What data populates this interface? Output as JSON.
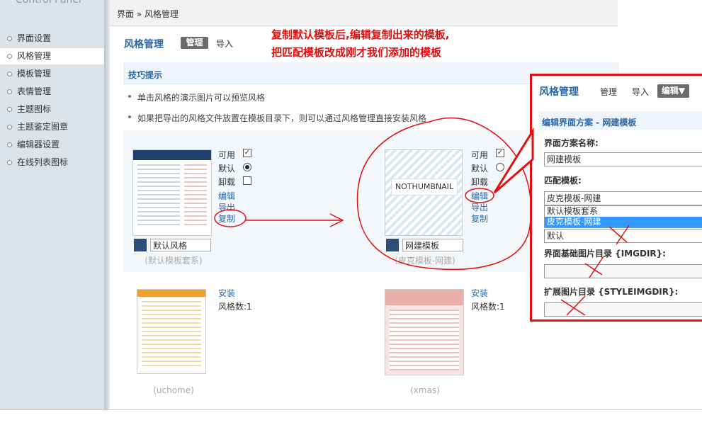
{
  "brand": "Control Panel",
  "nav": {
    "items": [
      {
        "label": "界面设置"
      },
      {
        "label": "风格管理",
        "active": true
      },
      {
        "label": "模板管理"
      },
      {
        "label": "表情管理"
      },
      {
        "label": "主题图标"
      },
      {
        "label": "主题鉴定图章"
      },
      {
        "label": "编辑器设置"
      },
      {
        "label": "在线列表图标"
      }
    ]
  },
  "breadcrumb": "界面 » 风格管理",
  "page": {
    "title": "风格管理",
    "tab_manage": "管理",
    "tab_import": "导入"
  },
  "annotation": {
    "line1": "复制默认模板后,编辑复制出来的模板,",
    "line2": "把匹配模板改成刚才我们添加的模板"
  },
  "tips": {
    "title": "技巧提示",
    "items": [
      "单击风格的演示图片可以预览风格",
      "如果把导出的风格文件放置在模板目录下，则可以通过风格管理直接安装风格"
    ]
  },
  "styles": [
    {
      "name": "默认风格",
      "template": "(默认模板套系)",
      "enabled_label": "可用",
      "default_label": "默认",
      "uninstall_label": "卸载",
      "edit": "编辑",
      "export": "导出",
      "copy": "复制",
      "enabled": true,
      "is_default": true
    },
    {
      "name": "网建模板",
      "template": "(皮克模板-网建)",
      "thumb_text": "NOTHUMBNAIL",
      "enabled_label": "可用",
      "default_label": "默认",
      "uninstall_label": "卸载",
      "edit": "编辑",
      "export": "导出",
      "copy": "复制",
      "enabled": true,
      "is_default": false
    }
  ],
  "installables": [
    {
      "install": "安装",
      "count": "风格数:1",
      "caption": "(uchome)"
    },
    {
      "install": "安装",
      "count": "风格数:1",
      "caption": "(xmas)"
    }
  ],
  "overlay": {
    "title": "风格管理",
    "tab_manage": "管理",
    "tab_import": "导入",
    "tab_edit": "编辑▼",
    "section": "编辑界面方案 - 网建模板",
    "name_label": "界面方案名称:",
    "name_value": "网建模板",
    "match_label": "匹配模板:",
    "match_selected": "皮克模板-网建",
    "match_options": [
      "默认模板套系",
      "皮克模板-网建"
    ],
    "default_value": "默认",
    "imgdir_label": "界面基础图片目录 {IMGDIR}:",
    "styleimgdir_label": "扩展图片目录 {STYLEIMGDIR}:"
  },
  "colors": {
    "accent": "#2a68a8",
    "annotation": "#e01010",
    "selected_option": "#3399ff"
  }
}
